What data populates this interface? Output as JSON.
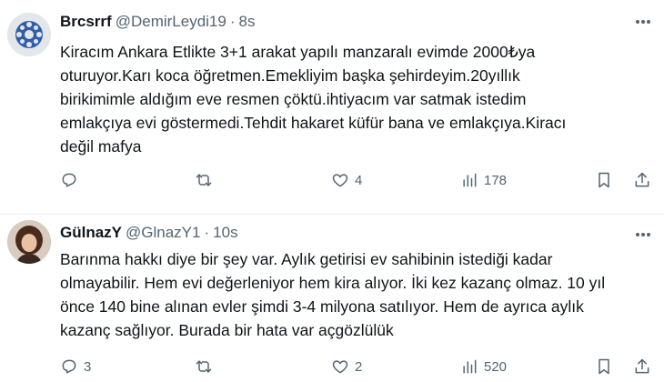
{
  "tweets": [
    {
      "name": "Brcsrrf",
      "handle": "@DemirLeydi19",
      "separator": "·",
      "time": "8s",
      "lines": [
        "Kiracım Ankara Etlikte 3+1 arakat yapılı manzaralı evimde 2000₺ya",
        "oturuyor.Karı koca öğretmen.Emekliyim başka şehirdeyim.20yıllık",
        "birikimimle aldığım eve resmen çöktü.ihtiyacım var satmak istedim",
        "emlakçıya evi göstermedi.Tehdit hakaret küfür bana ve emlakçıya.Kiracı",
        "değil mafya"
      ],
      "reply_count": "",
      "retweet_count": "",
      "like_count": "4",
      "view_count": "178",
      "avatar_icon": "wheel-logo-avatar"
    },
    {
      "name": "GülnazY",
      "handle": "@GlnazY1",
      "separator": "·",
      "time": "10s",
      "lines": [
        "Barınma hakkı diye bir şey var. Aylık getirisi ev sahibinin  istediği kadar",
        "olmayabilir. Hem evi değerleniyor hem kira alıyor. İki kez kazanç olmaz. 10 yıl",
        "önce 140 bine alınan evler şimdi 3-4 milyona satılıyor. Hem de ayrıca aylık",
        "kazanç sağlıyor. Burada bir hata var açgözlülük"
      ],
      "reply_count": "3",
      "retweet_count": "",
      "like_count": "2",
      "view_count": "520",
      "avatar_icon": "profile-photo-avatar"
    }
  ],
  "colors": {
    "text": "#0f1419",
    "secondary": "#536471",
    "divider": "#eff3f4"
  }
}
